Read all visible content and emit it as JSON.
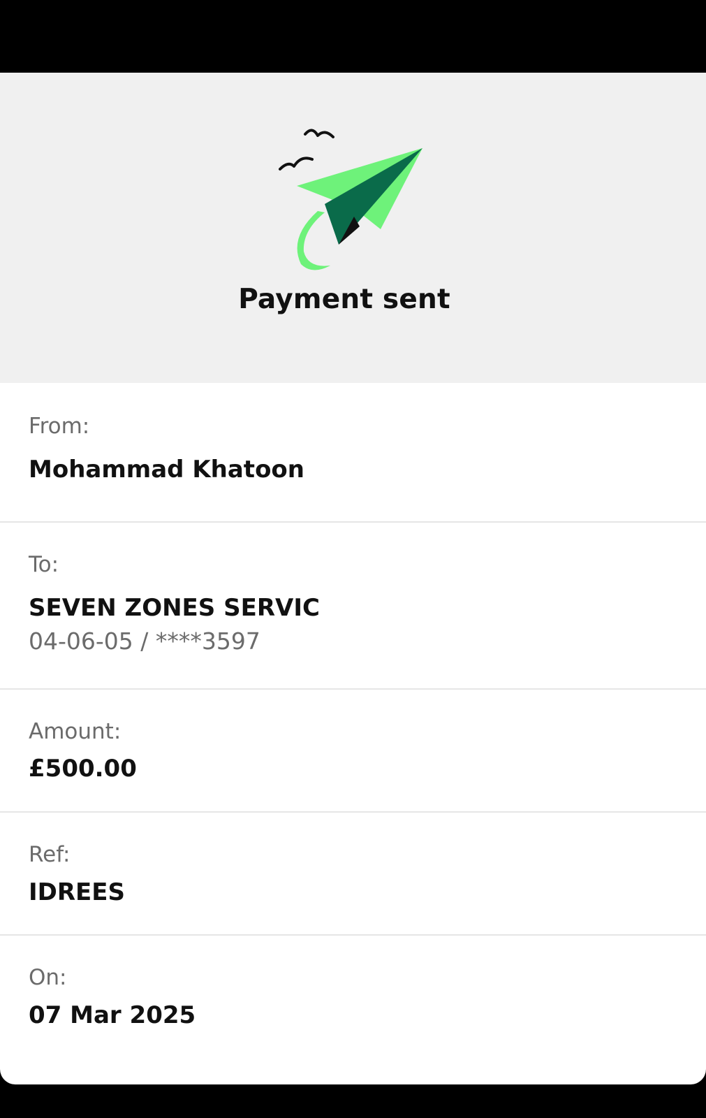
{
  "header": {
    "title": "Payment sent",
    "background_color": "#f0f0f0",
    "illustration": "paper-plane-with-birds",
    "accent_light": "#6ef27a",
    "accent_dark": "#0a6b4a"
  },
  "details": {
    "from": {
      "label": "From:",
      "value": "Mohammad Khatoon"
    },
    "to": {
      "label": "To:",
      "value": "SEVEN ZONES SERVIC",
      "account": "04-06-05 / ****3597"
    },
    "amount": {
      "label": "Amount:",
      "value": "£500.00"
    },
    "ref": {
      "label": "Ref:",
      "value": "IDREES"
    },
    "on": {
      "label": "On:",
      "value": "07 Mar 2025"
    }
  }
}
